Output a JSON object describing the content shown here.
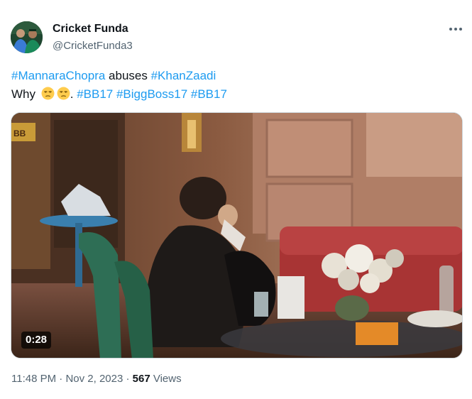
{
  "author": {
    "display_name": "Cricket Funda",
    "handle": "@CricketFunda3"
  },
  "tweet": {
    "line1": {
      "tag1": "#MannaraChopra",
      "text": " abuses ",
      "tag2": "#KhanZaadi"
    },
    "line2": {
      "text_why": "Why ",
      "text_dot": ". ",
      "tags": [
        "#BB17",
        "#BiggBoss17",
        "#BB17"
      ],
      "emoji_icons": [
        "unamused-face-icon",
        "unamused-face-icon"
      ]
    }
  },
  "media": {
    "duration": "0:28",
    "overlay_logo_text": "BB"
  },
  "meta": {
    "time": "11:48 PM",
    "separator": " · ",
    "date": "Nov 2, 2023",
    "views_count": "567",
    "views_label": " Views"
  },
  "colors": {
    "link": "#1d9bf0",
    "secondary_text": "#536471",
    "primary_text": "#0f1419"
  }
}
